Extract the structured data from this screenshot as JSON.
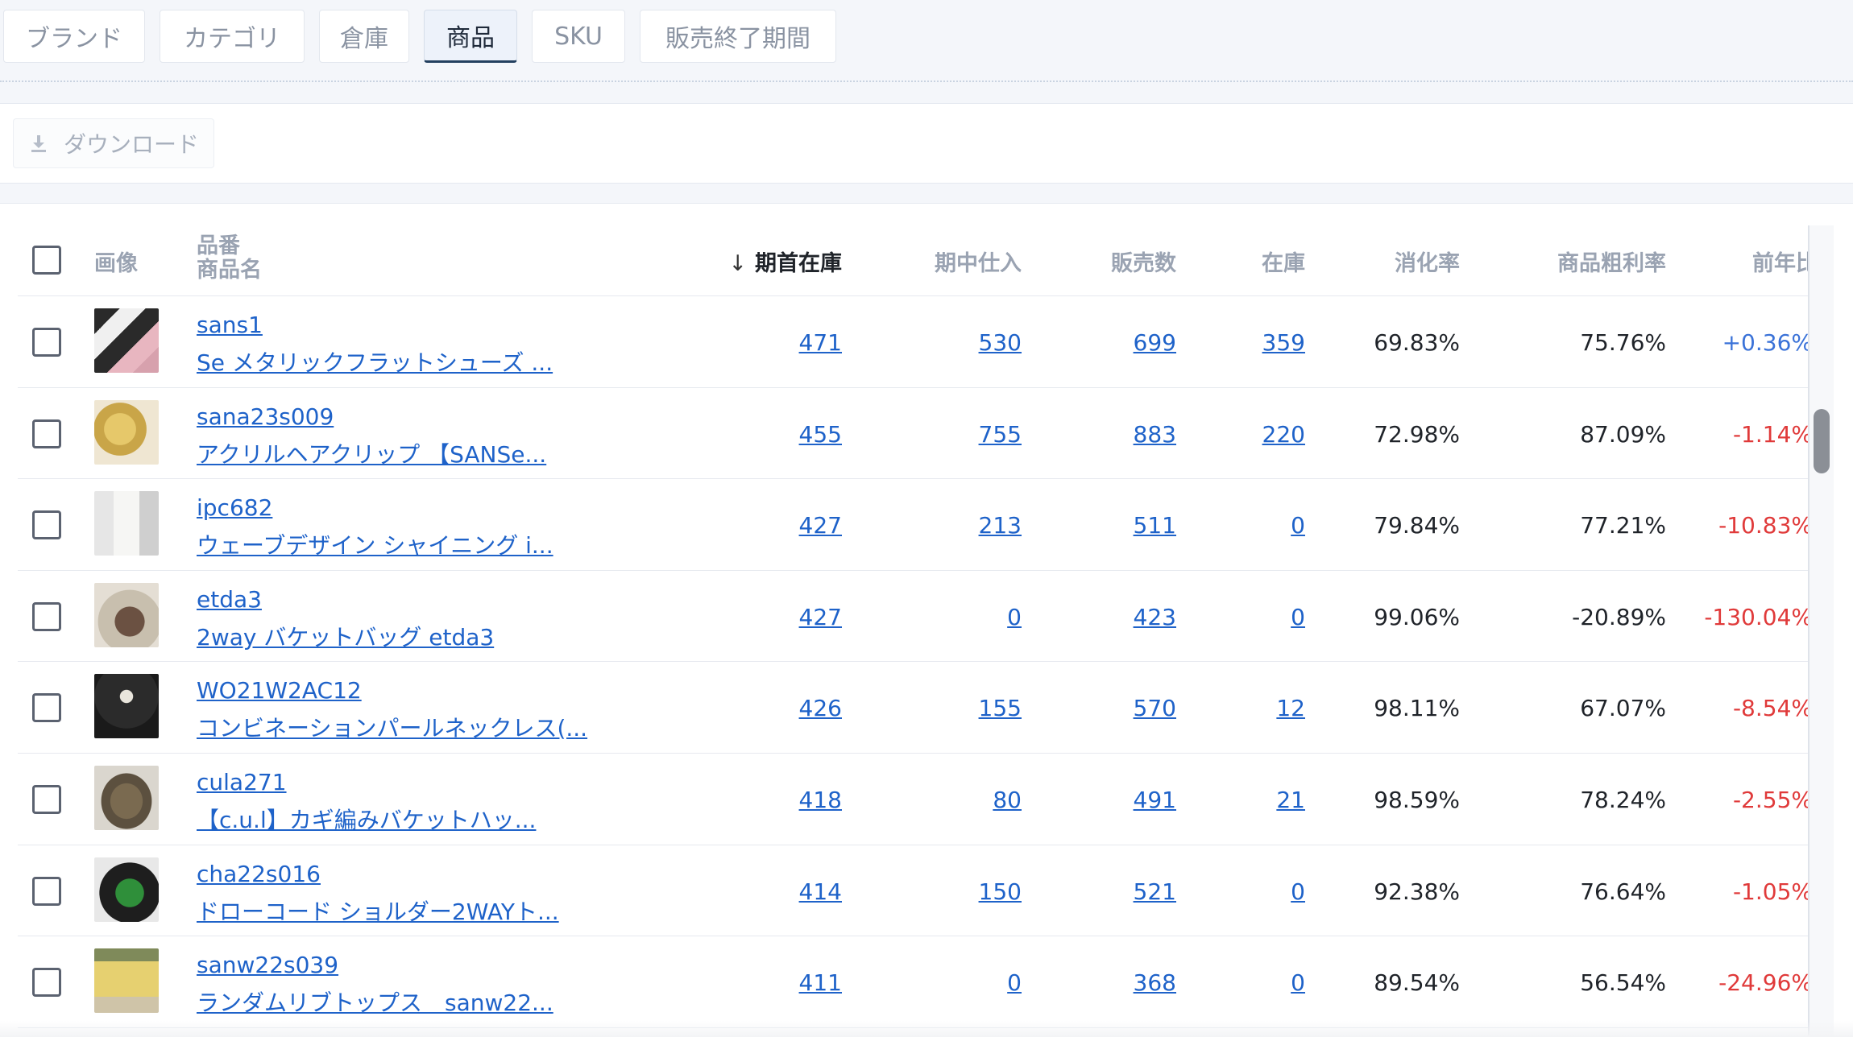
{
  "tabs": [
    {
      "label": "ブランド"
    },
    {
      "label": "カテゴリ"
    },
    {
      "label": "倉庫"
    },
    {
      "label": "商品"
    },
    {
      "label": "SKU"
    },
    {
      "label": "販売終了期間"
    }
  ],
  "active_tab": "商品",
  "toolbar": {
    "download_label": "ダウンロード",
    "download_icon": "download-icon"
  },
  "table": {
    "headers": {
      "image": "画像",
      "code_line1": "品番",
      "code_line2": "商品名",
      "opening_stock": "期首在庫",
      "purchases": "期中仕入",
      "sales": "販売数",
      "stock": "在庫",
      "sell_through": "消化率",
      "gross_margin": "商品粗利率",
      "yoy": "前年比"
    },
    "sort": {
      "column": "期首在庫",
      "direction": "desc",
      "icon": "arrow-down-icon"
    },
    "rows": [
      {
        "code": "sans1",
        "name": "Se メタリックフラットシューズ ...",
        "opening_stock": "471",
        "purchases": "530",
        "sales": "699",
        "stock": "359",
        "sell_through": "69.83%",
        "gross_margin": "75.76%",
        "yoy": "+0.36%"
      },
      {
        "code": "sana23s009",
        "name": "アクリルヘアクリップ 【SANSe...",
        "opening_stock": "455",
        "purchases": "755",
        "sales": "883",
        "stock": "220",
        "sell_through": "72.98%",
        "gross_margin": "87.09%",
        "yoy": "-1.14%"
      },
      {
        "code": "ipc682",
        "name": "ウェーブデザイン シャイニング i...",
        "opening_stock": "427",
        "purchases": "213",
        "sales": "511",
        "stock": "0",
        "sell_through": "79.84%",
        "gross_margin": "77.21%",
        "yoy": "-10.83%"
      },
      {
        "code": "etda3",
        "name": "2way バケットバッグ etda3",
        "opening_stock": "427",
        "purchases": "0",
        "sales": "423",
        "stock": "0",
        "sell_through": "99.06%",
        "gross_margin": "-20.89%",
        "yoy": "-130.04%"
      },
      {
        "code": "WO21W2AC12",
        "name": "コンビネーションパールネックレス(...",
        "opening_stock": "426",
        "purchases": "155",
        "sales": "570",
        "stock": "12",
        "sell_through": "98.11%",
        "gross_margin": "67.07%",
        "yoy": "-8.54%"
      },
      {
        "code": "cula271",
        "name": "【c.u.l】カギ編みバケットハッ...",
        "opening_stock": "418",
        "purchases": "80",
        "sales": "491",
        "stock": "21",
        "sell_through": "98.59%",
        "gross_margin": "78.24%",
        "yoy": "-2.55%"
      },
      {
        "code": "cha22s016",
        "name": "ドローコード ショルダー2WAYト...",
        "opening_stock": "414",
        "purchases": "150",
        "sales": "521",
        "stock": "0",
        "sell_through": "92.38%",
        "gross_margin": "76.64%",
        "yoy": "-1.05%"
      },
      {
        "code": "sanw22s039",
        "name": "ランダムリブトップス　sanw22...",
        "opening_stock": "411",
        "purchases": "0",
        "sales": "368",
        "stock": "0",
        "sell_through": "89.54%",
        "gross_margin": "56.54%",
        "yoy": "-24.96%"
      }
    ]
  },
  "colors": {
    "link": "#1e62c9",
    "negative": "#e03a3a",
    "positive": "#3a72d8",
    "header_text": "#9aa3b2"
  }
}
